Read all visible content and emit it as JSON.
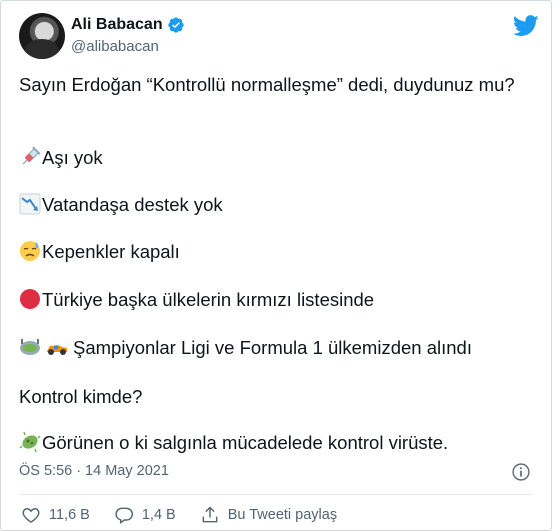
{
  "tweet": {
    "author": {
      "display_name": "Ali Babacan",
      "handle": "@alibabacan",
      "verified": true
    },
    "text": {
      "intro": "Sayın Erdoğan “Kontrollü normalleşme” dedi, duydunuz mu?",
      "item1": "Aşı yok",
      "item2": "Vatandaşa destek yok",
      "item3": "Kepenkler kapalı",
      "item4": "Türkiye başka ülkelerin kırmızı listesinde",
      "item5": "Şampiyonlar Ligi ve Formula 1 ülkemizden alındı",
      "question": "Kontrol kimde?",
      "closing": "Görünen o ki salgınla mücadelede kontrol virüste."
    },
    "emoji_icons": [
      "syringe-icon",
      "chart-decreasing-icon",
      "downcast-face-icon",
      "red-circle-icon",
      "stadium-icon",
      "race-car-icon",
      "microbe-icon"
    ],
    "timestamp": {
      "time": "ÖS 5:56",
      "separator": "·",
      "date": "14 May 2021"
    },
    "actions": {
      "likes": "11,6 B",
      "replies": "1,4 B",
      "share_label": "Bu Tweeti paylaş"
    }
  },
  "colors": {
    "twitter_blue": "#1d9bf0",
    "text_primary": "#0f1419",
    "text_secondary": "#536471",
    "like_red": "#f91880"
  }
}
